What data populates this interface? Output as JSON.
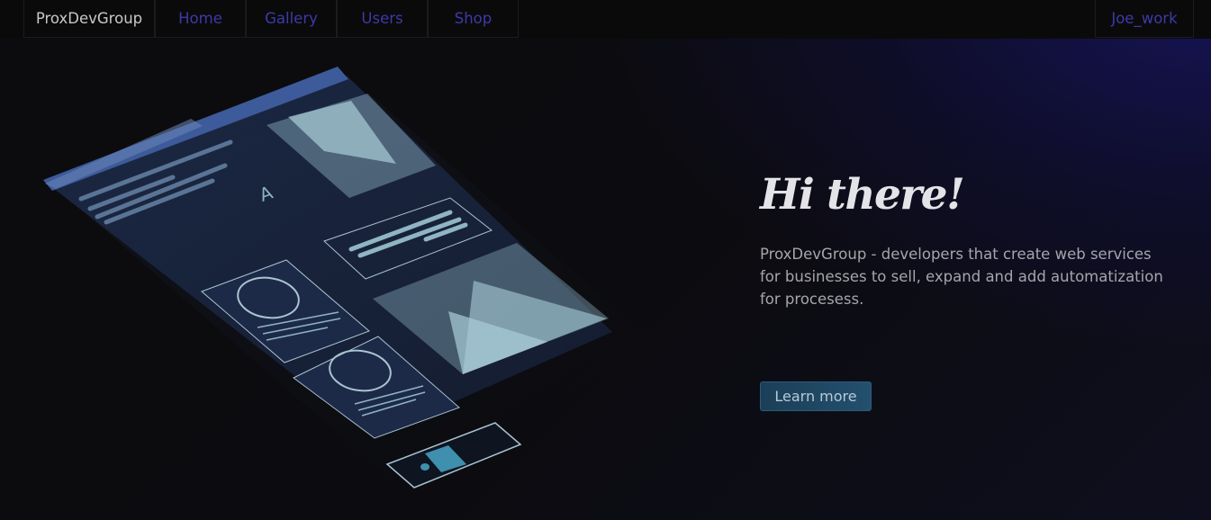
{
  "nav": {
    "brand": "ProxDevGroup",
    "links": [
      {
        "label": "Home"
      },
      {
        "label": "Gallery"
      },
      {
        "label": "Users"
      },
      {
        "label": "Shop"
      }
    ],
    "user": "Joe_work"
  },
  "hero": {
    "title": "Hi there!",
    "description": "ProxDevGroup - developers that create web services for businesses to sell, expand and add automatization for procesess.",
    "button_label": "Learn more"
  },
  "illustration": {
    "glyph": "A",
    "colors": {
      "panel": "#1b2640",
      "accent_bar": "#3d5a9a",
      "light_shape": "#8fb4c4",
      "outline": "#a9c3d0",
      "slider_accent": "#3f8fae"
    }
  },
  "colors": {
    "background": "#0c0c0e",
    "nav_link": "#3d3aa8",
    "brand_text": "#c8c8cc",
    "title": "#e4e4e8",
    "body_text": "#a5a5ab",
    "button_bg": "#1f4864"
  }
}
